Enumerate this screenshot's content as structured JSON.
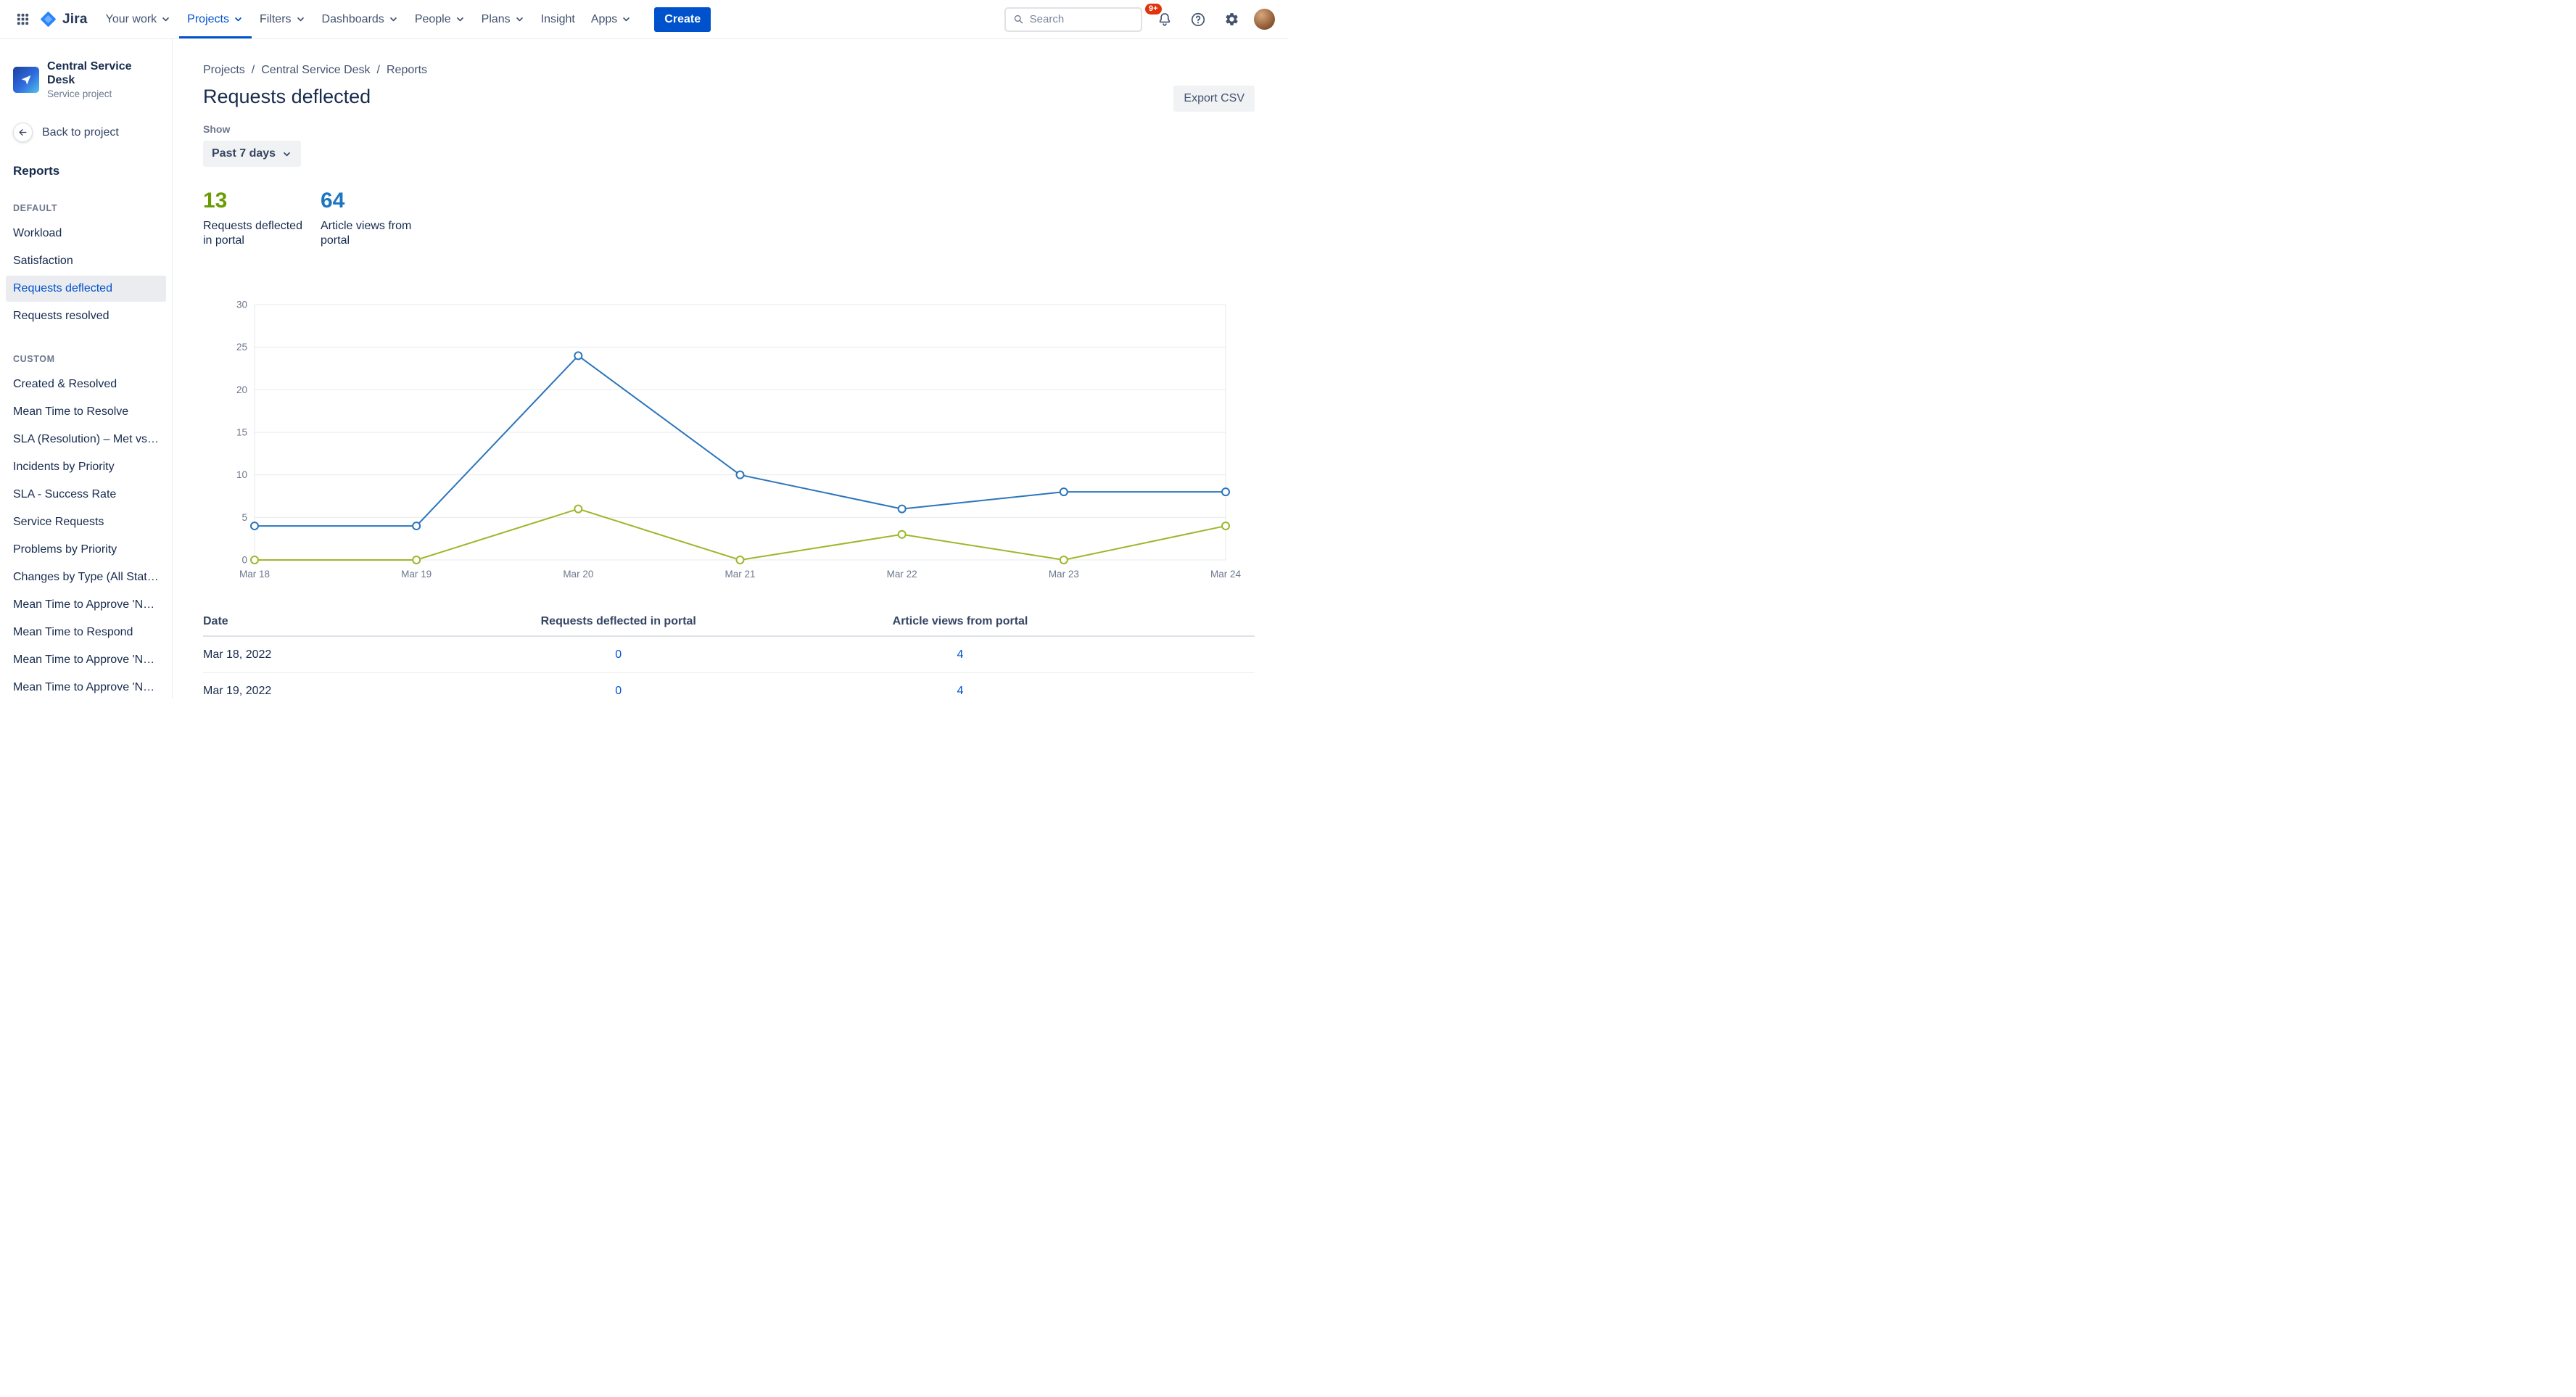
{
  "nav": {
    "brand": "Jira",
    "items": [
      {
        "label": "Your work",
        "chevron": true
      },
      {
        "label": "Projects",
        "chevron": true,
        "active": true
      },
      {
        "label": "Filters",
        "chevron": true
      },
      {
        "label": "Dashboards",
        "chevron": true
      },
      {
        "label": "People",
        "chevron": true
      },
      {
        "label": "Plans",
        "chevron": true
      },
      {
        "label": "Insight",
        "chevron": false
      },
      {
        "label": "Apps",
        "chevron": true
      }
    ],
    "create_label": "Create",
    "search_placeholder": "Search",
    "notification_badge": "9+"
  },
  "sidebar": {
    "project_name": "Central Service Desk",
    "project_type": "Service project",
    "back_label": "Back to project",
    "reports_heading": "Reports",
    "groups": [
      {
        "title": "DEFAULT",
        "selected": "Requests deflected",
        "items": [
          "Workload",
          "Satisfaction",
          "Requests deflected",
          "Requests resolved"
        ]
      },
      {
        "title": "CUSTOM",
        "items": [
          "Created & Resolved",
          "Mean Time to Resolve",
          "SLA (Resolution) – Met vs Bre...",
          "Incidents by Priority",
          "SLA - Success Rate",
          "Service Requests",
          "Problems by Priority",
          "Changes by Type (All Statuses)",
          "Mean Time to Approve 'Norm...",
          "Mean Time to Respond",
          "Mean Time to Approve 'Norm...",
          "Mean Time to Approve 'Norm..."
        ]
      }
    ]
  },
  "main": {
    "breadcrumbs": [
      "Projects",
      "Central Service Desk",
      "Reports"
    ],
    "title": "Requests deflected",
    "export_label": "Export CSV",
    "show_label": "Show",
    "period_value": "Past 7 days",
    "stats": [
      {
        "value": "13",
        "label": "Requests deflected in portal",
        "color": "#6a9b01"
      },
      {
        "value": "64",
        "label": "Article views from portal",
        "color": "#1d76c2"
      }
    ]
  },
  "chart_data": {
    "type": "line",
    "title": "Requests deflected vs article views, past 7 days",
    "x": [
      "Mar 18",
      "Mar 19",
      "Mar 20",
      "Mar 21",
      "Mar 22",
      "Mar 23",
      "Mar 24"
    ],
    "series": [
      {
        "name": "Requests deflected in portal",
        "color": "#9cb72b",
        "values": [
          0,
          0,
          6,
          0,
          3,
          0,
          4
        ]
      },
      {
        "name": "Article views from portal",
        "color": "#2b75bb",
        "values": [
          4,
          4,
          24,
          10,
          6,
          8,
          8
        ]
      }
    ],
    "ylim": [
      0,
      30
    ],
    "yticks": [
      0,
      5,
      10,
      15,
      20,
      25,
      30
    ],
    "grid": true,
    "legend": "none"
  },
  "table": {
    "headers": [
      "Date",
      "Requests deflected in portal",
      "Article views from portal"
    ],
    "rows": [
      {
        "date": "Mar 18, 2022",
        "deflected": "0",
        "views": "4"
      },
      {
        "date": "Mar 19, 2022",
        "deflected": "0",
        "views": "4"
      }
    ]
  }
}
